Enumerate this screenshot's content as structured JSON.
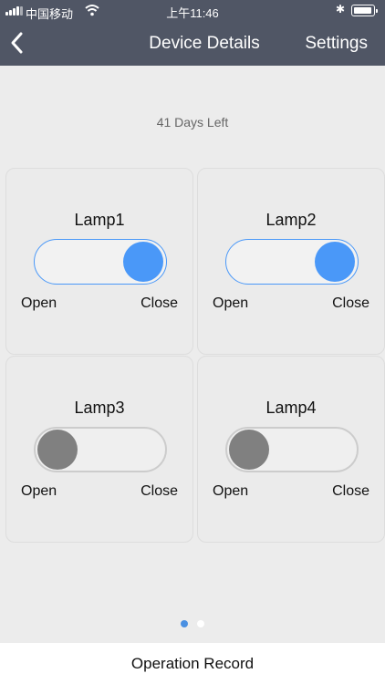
{
  "status_bar": {
    "carrier": "中国移动",
    "time": "上午11:46",
    "icons": [
      "signal-icon",
      "wifi-icon",
      "bluetooth-icon",
      "battery-icon"
    ]
  },
  "nav": {
    "back_icon": "chevron-left-icon",
    "title": "Device Details",
    "settings_label": "Settings"
  },
  "days_left": "41 Days Left",
  "lamps": [
    {
      "name": "Lamp1",
      "open_label": "Open",
      "close_label": "Close",
      "state": "on"
    },
    {
      "name": "Lamp2",
      "open_label": "Open",
      "close_label": "Close",
      "state": "on"
    },
    {
      "name": "Lamp3",
      "open_label": "Open",
      "close_label": "Close",
      "state": "off"
    },
    {
      "name": "Lamp4",
      "open_label": "Open",
      "close_label": "Close",
      "state": "off"
    }
  ],
  "pager": {
    "pages": 2,
    "current": 1
  },
  "footer": {
    "operation_record_label": "Operation Record"
  },
  "colors": {
    "header_bg": "#505665",
    "accent_blue": "#4a98f8",
    "knob_off": "#808080",
    "page_bg": "#ececec"
  }
}
